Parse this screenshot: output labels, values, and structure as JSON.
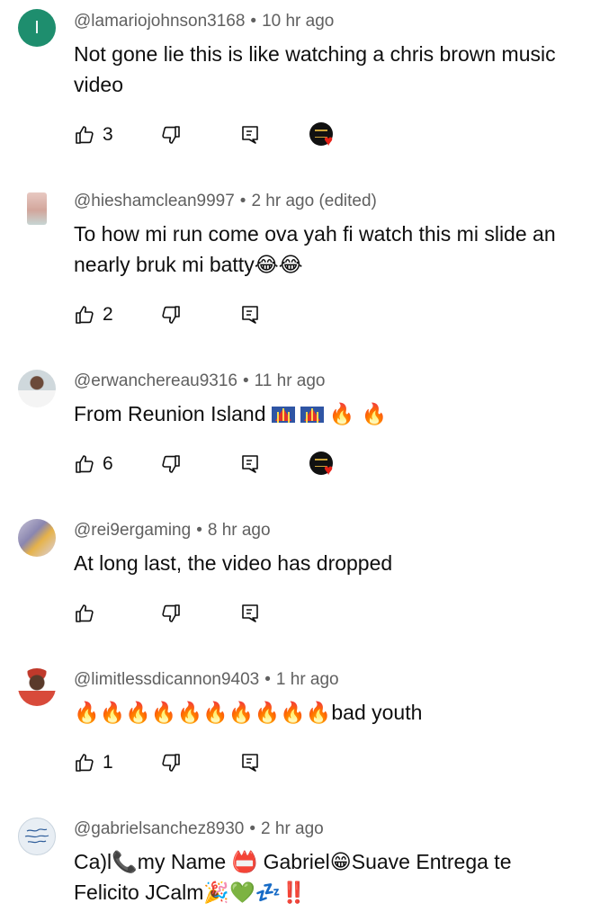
{
  "comments": [
    {
      "avatar_letter": "I",
      "author": "@lamariojohnson3168",
      "time": "10 hr ago",
      "text": "Not gone lie this is like watching a chris brown music video",
      "likes": "3",
      "hearted": true
    },
    {
      "author": "@hieshamclean9997",
      "time": "2 hr ago (edited)",
      "text": "To how mi run come ova yah fi watch this mi slide an nearly bruk mi batty😂😂",
      "likes": "2",
      "hearted": false
    },
    {
      "author": "@erwanchereau9316",
      "time": "11 hr ago",
      "text": "From Reunion Island",
      "text_emoji": "🔥 🔥",
      "likes": "6",
      "hearted": true
    },
    {
      "author": "@rei9ergaming",
      "time": "8 hr ago",
      "text": "At long last, the video has dropped",
      "likes": "",
      "hearted": false
    },
    {
      "author": "@limitlessdicannon9403",
      "time": "1 hr ago",
      "text": "🔥🔥🔥🔥🔥🔥🔥🔥🔥🔥bad youth",
      "likes": "1",
      "hearted": false
    },
    {
      "author": "@gabrielsanchez8930",
      "time": "2 hr ago",
      "text": "Ca)l📞my Name 📛 Gabriel😁Suave Entrega te Felicito JCalm🎉💚💤‼️",
      "likes": "",
      "hearted": false
    }
  ],
  "icons": {
    "like": "thumb-up-icon",
    "dislike": "thumb-down-icon",
    "reply": "reply-comment-icon",
    "heart": "creator-heart-icon"
  },
  "colors": {
    "meta_text": "#606060",
    "heart": "#e62117",
    "avatar_letter_bg": "#1e8e6e"
  }
}
